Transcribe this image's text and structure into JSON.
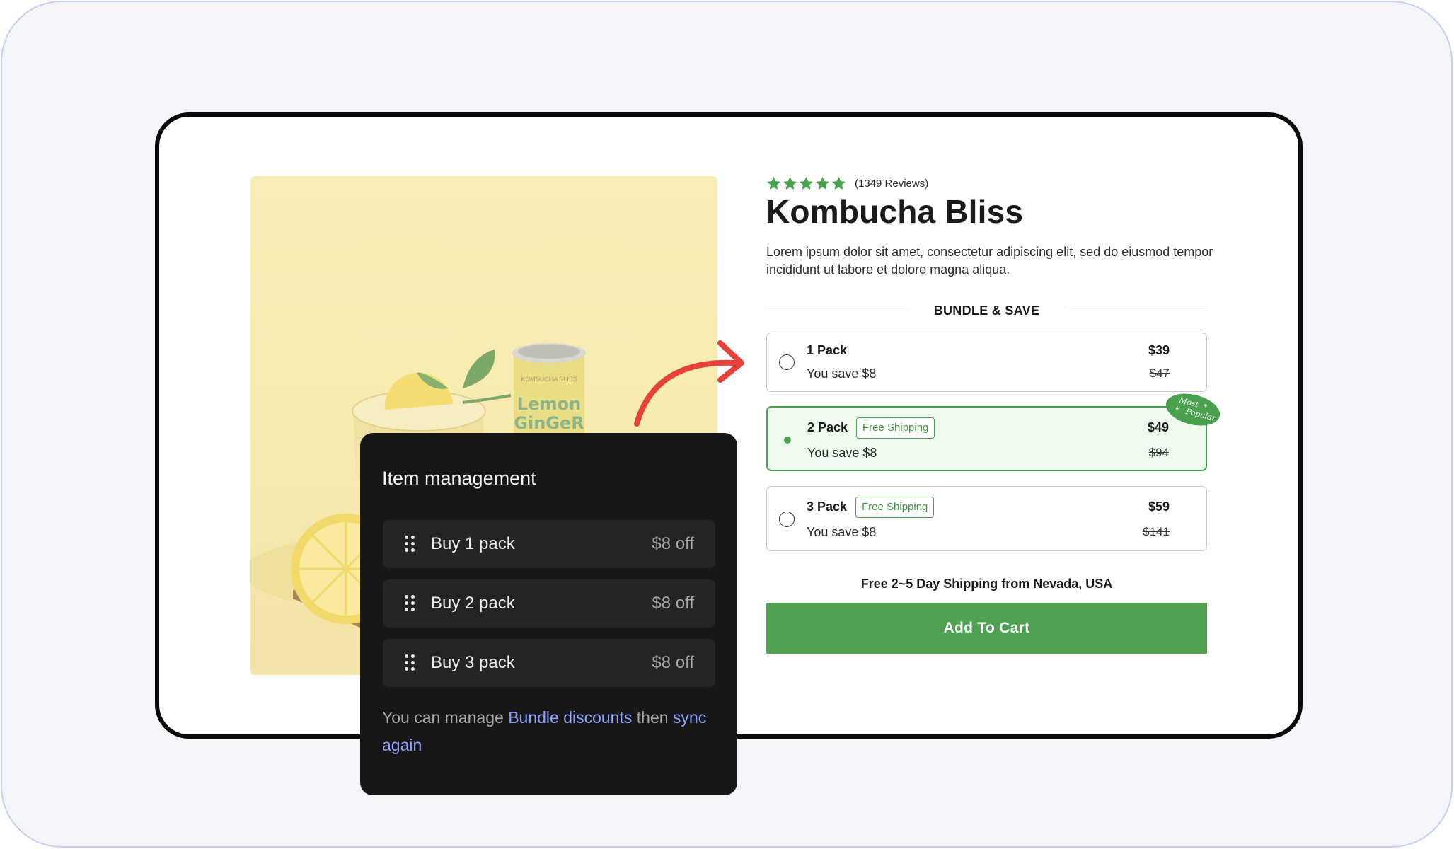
{
  "product": {
    "rating_stars": 5,
    "review_count": "(1349 Reviews)",
    "title": "Kombucha Bliss",
    "description": "Lorem ipsum dolor sit amet, consectetur adipiscing elit, sed do eiusmod tempor incididunt ut labore et dolore magna aliqua.",
    "image": {
      "can_brand": "KOMBUCHA BLISS",
      "can_flavor_line1": "Lemon",
      "can_flavor_line2": "GinGeR"
    }
  },
  "bundle": {
    "header": "BUNDLE & SAVE",
    "options": [
      {
        "name": "1 Pack",
        "badge": "",
        "savings": "You save $8",
        "price": "$39",
        "original_price": "$47",
        "selected": false
      },
      {
        "name": "2 Pack",
        "badge": "Free Shipping",
        "savings": "You save $8",
        "price": "$49",
        "original_price": "$94",
        "selected": true
      },
      {
        "name": "3 Pack",
        "badge": "Free Shipping",
        "savings": "You save $8",
        "price": "$59",
        "original_price": "$141",
        "selected": false
      }
    ],
    "popular_tag": {
      "line1": "Most",
      "line2": "Popular"
    }
  },
  "shipping_note": "Free 2~5 Day Shipping from Nevada, USA",
  "add_to_cart_label": "Add To Cart",
  "item_management": {
    "title": "Item management",
    "items": [
      {
        "label": "Buy 1 pack",
        "discount": "$8 off"
      },
      {
        "label": "Buy 2 pack",
        "discount": "$8 off"
      },
      {
        "label": "Buy 3 pack",
        "discount": "$8 off"
      }
    ],
    "footer_prefix": "You can manage",
    "footer_link": "Bundle discounts",
    "footer_middle": "then",
    "footer_link2": "sync again"
  },
  "colors": {
    "accent_green": "#4fa252",
    "panel_bg": "#171717",
    "link_blue": "#8fa3ff",
    "arrow_red": "#e8413a",
    "frame_border": "#c6d0f5"
  },
  "icons": {
    "star": "star-icon",
    "grip": "drag-handle-icon",
    "arrow": "curved-arrow-icon"
  }
}
